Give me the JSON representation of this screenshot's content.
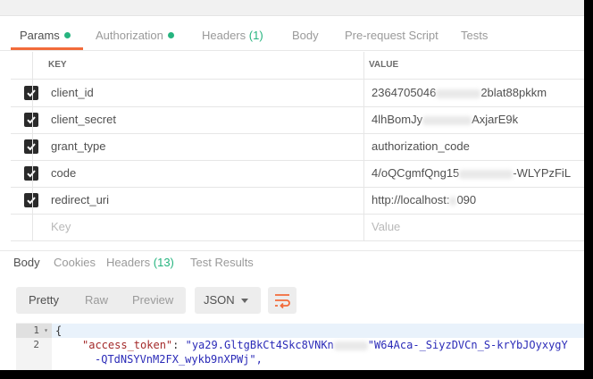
{
  "request_tabs": [
    {
      "label": "Params",
      "active": true,
      "dot": true
    },
    {
      "label": "Authorization",
      "dot": true
    },
    {
      "label": "Headers",
      "count": "(1)"
    },
    {
      "label": "Body"
    },
    {
      "label": "Pre-request Script"
    },
    {
      "label": "Tests"
    }
  ],
  "params_table": {
    "header_key": "KEY",
    "header_value": "VALUE",
    "rows": [
      {
        "checked": true,
        "key": "client_id",
        "value_start": "2364705046",
        "value_end": "2blat88pkkm"
      },
      {
        "checked": true,
        "key": "client_secret",
        "value_start": "4lhBomJy",
        "value_end": "AxjarE9k"
      },
      {
        "checked": true,
        "key": "grant_type",
        "value_start": "authorization_code",
        "value_end": ""
      },
      {
        "checked": true,
        "key": "code",
        "value_start": "4/oQCgmfQng15",
        "value_end": "-WLYPzFiL"
      },
      {
        "checked": true,
        "key": "redirect_uri",
        "value_start": "http://localhost:",
        "value_end": "090"
      }
    ],
    "empty_key_placeholder": "Key",
    "empty_value_placeholder": "Value"
  },
  "response_tabs": [
    {
      "label": "Body",
      "active": true
    },
    {
      "label": "Cookies"
    },
    {
      "label": "Headers",
      "count": "(13)"
    },
    {
      "label": "Test Results"
    }
  ],
  "view_modes": [
    "Pretty",
    "Raw",
    "Preview"
  ],
  "selected_view_mode": "Pretty",
  "format": "JSON",
  "code": {
    "line1": "{",
    "line2_key": "\"access_token\"",
    "line2_sep": ": ",
    "line2_val_start": "\"ya29.GltgBkCt4Skc8VNKn",
    "line2_val_end": "\"W64Aca-_SiyzDVCn_S-krYbJOyxygY",
    "line3": "-QTdNSYVnM2FX_wykb9nXPWj\",",
    "line_numbers": [
      "1",
      "2"
    ]
  },
  "colors": {
    "accent_orange": "#f26b3a",
    "status_green": "#26b47f"
  }
}
